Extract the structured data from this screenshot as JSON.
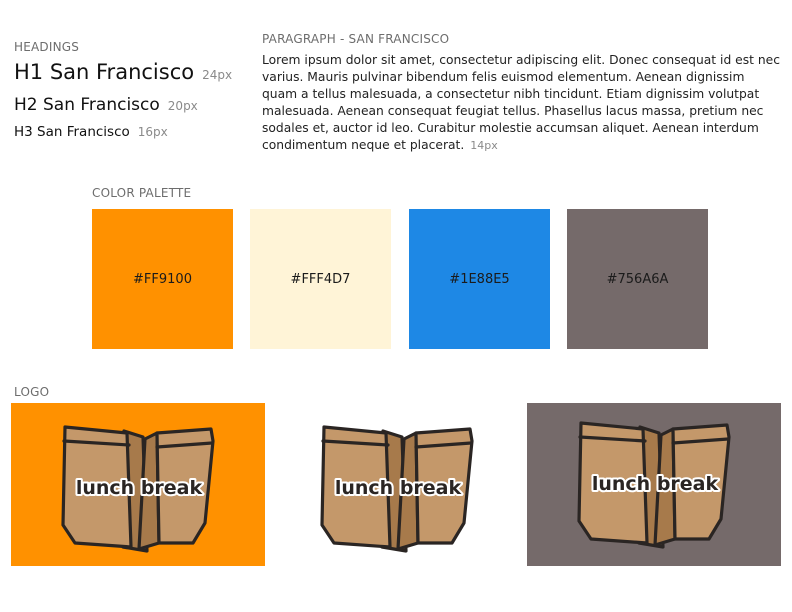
{
  "headings": {
    "label": "HEADINGS",
    "items": [
      {
        "text": "H1 San Francisco",
        "size": "24px"
      },
      {
        "text": "H2 San Francisco",
        "size": "20px"
      },
      {
        "text": "H3 San Francisco",
        "size": "16px"
      }
    ]
  },
  "paragraph": {
    "label": "PARAGRAPH - SAN FRANCISCO",
    "text": "Lorem ipsum dolor sit amet, consectetur adipiscing elit. Donec consequat id est nec varius. Mauris pulvinar bibendum felis euismod elementum. Aenean dignissim quam a tellus malesuada, a consectetur nibh tincidunt. Etiam dignissim volutpat malesuada. Aenean consequat feugiat tellus. Phasellus lacus massa, pretium nec sodales et, auctor id leo. Curabitur molestie accumsan aliquet. Aenean interdum condimentum neque et placerat.",
    "size": "14px"
  },
  "palette": {
    "label": "COLOR PALETTE",
    "colors": [
      {
        "hex": "#FF9100",
        "label": "#FF9100"
      },
      {
        "hex": "#FFF4D7",
        "label": "#FFF4D7"
      },
      {
        "hex": "#1E88E5",
        "label": "#1E88E5"
      },
      {
        "hex": "#756A6A",
        "label": "#756A6A"
      }
    ]
  },
  "logo": {
    "label": "LOGO",
    "text": "lunch break",
    "icon": "paper-bag-icon",
    "backgrounds": [
      "#FF9100",
      "#FFFFFF",
      "#756A6A"
    ],
    "bag_fill": "#C4986A",
    "bag_shade": "#A77A4B",
    "outline": "#2A2523"
  }
}
